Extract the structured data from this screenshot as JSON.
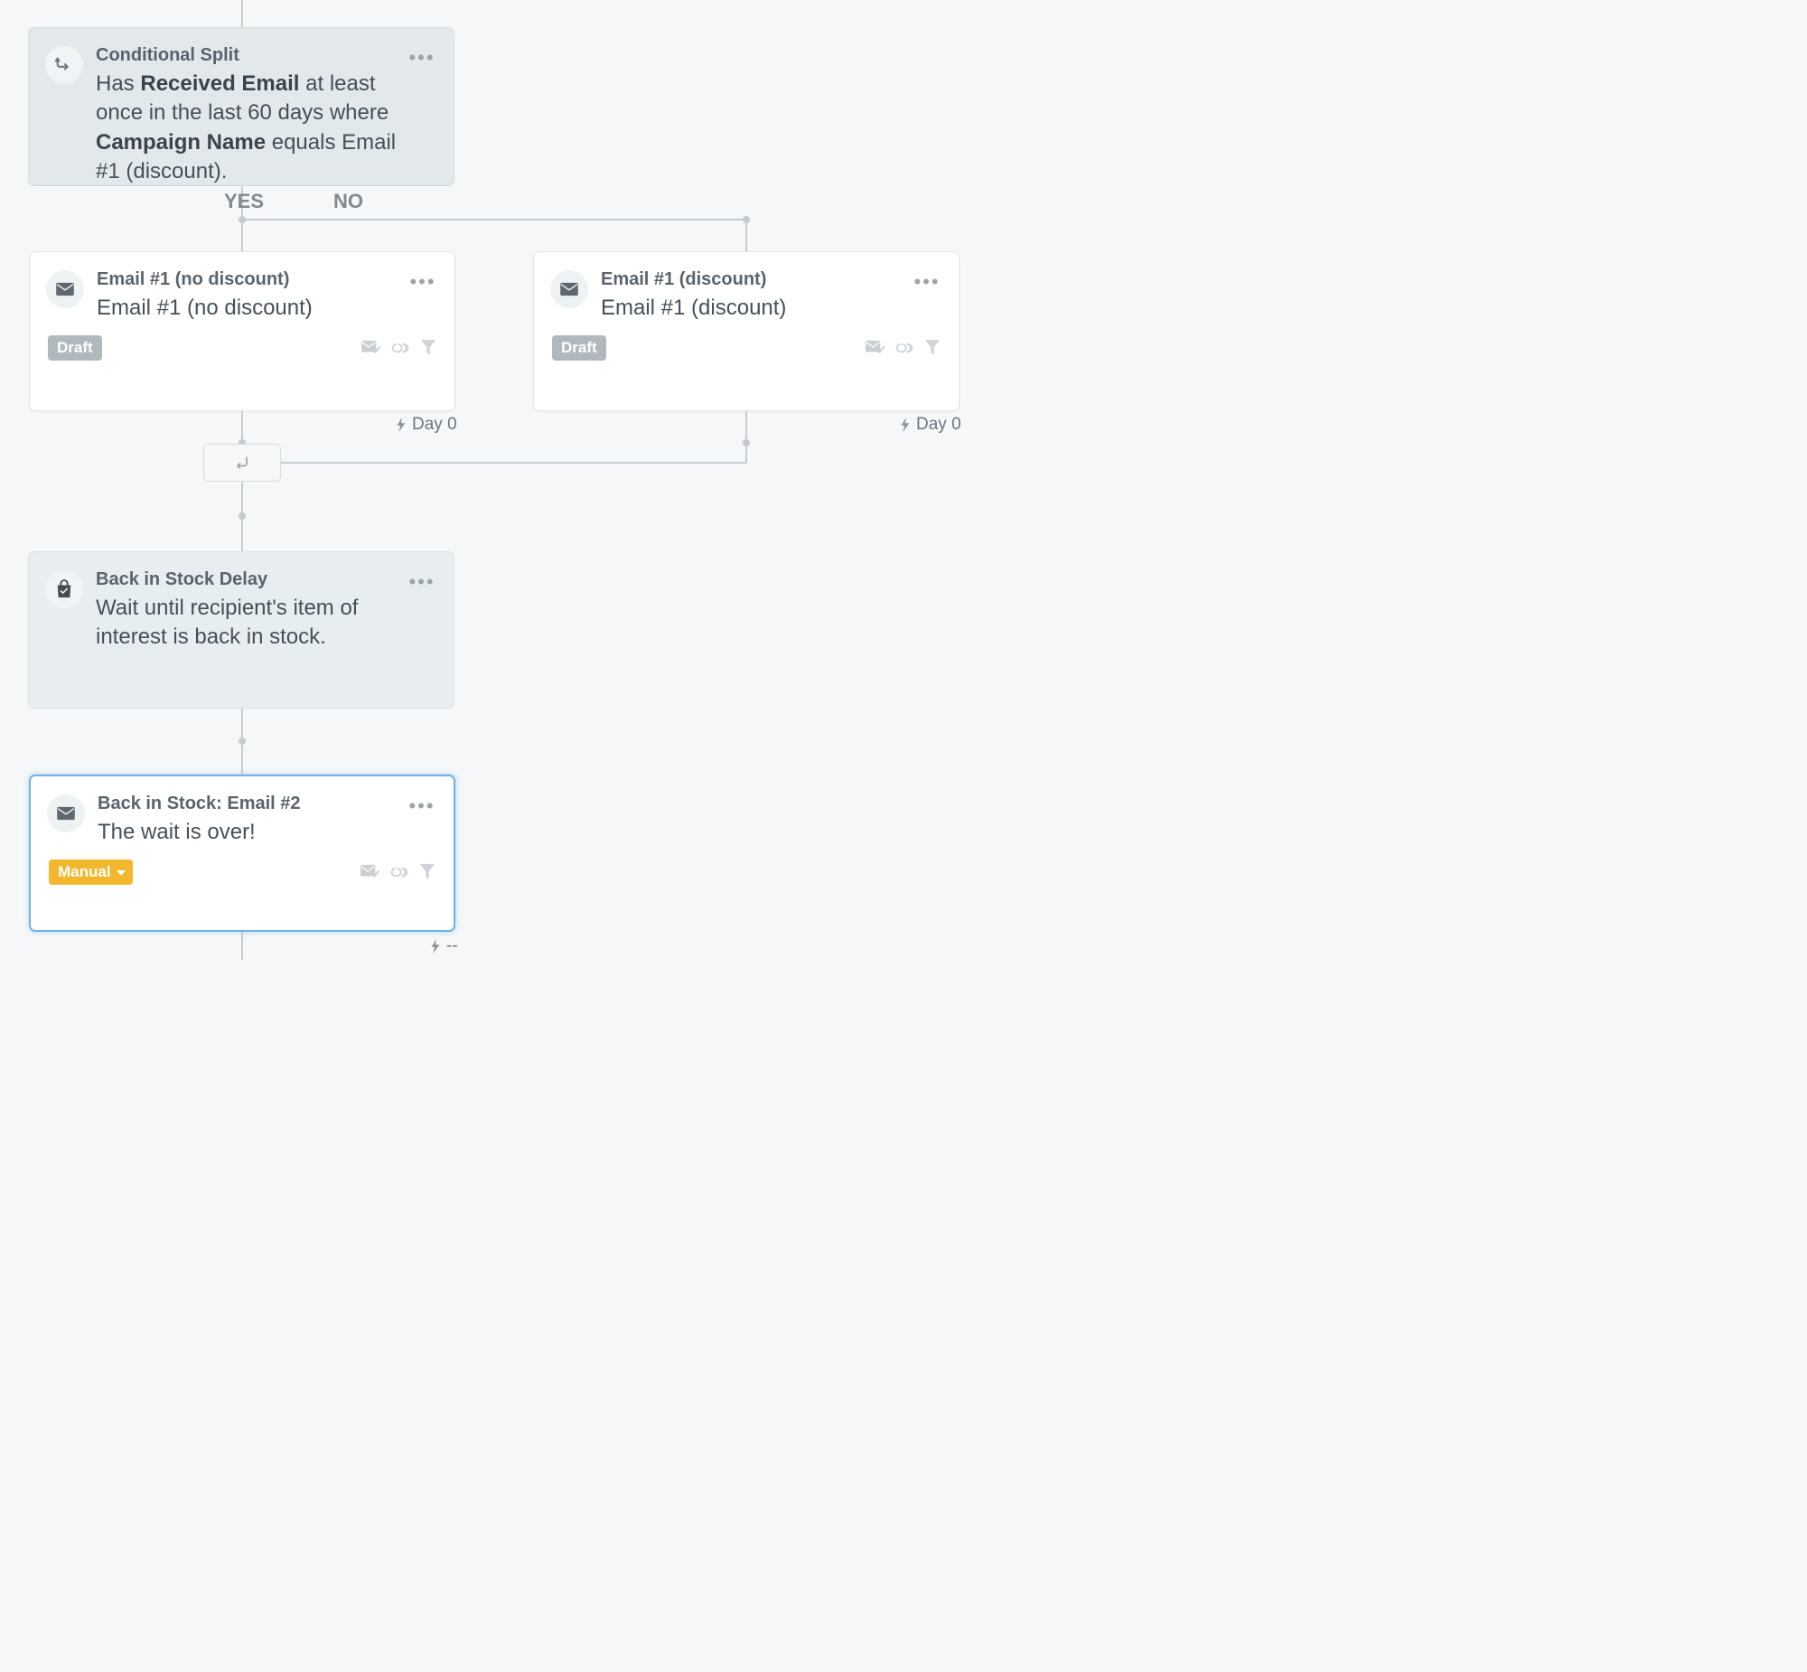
{
  "conditional": {
    "title": "Conditional Split",
    "desc_p1": "Has ",
    "desc_b1": "Received Email",
    "desc_p2": " at least once in the last 60 days where ",
    "desc_b2": "Campaign Name",
    "desc_p3": " equals Email #1 (discount)."
  },
  "branch": {
    "yes": "YES",
    "no": "NO"
  },
  "email_no_discount": {
    "title": "Email #1 (no discount)",
    "subject": "Email #1 (no discount)",
    "status": "Draft",
    "day": "Day 0"
  },
  "email_discount": {
    "title": "Email #1 (discount)",
    "subject": "Email #1 (discount)",
    "status": "Draft",
    "day": "Day 0"
  },
  "back_in_stock_delay": {
    "title": "Back in Stock Delay",
    "desc": "Wait until recipient's item of interest is back in stock."
  },
  "email2": {
    "title": "Back in Stock: Email #2",
    "subject": "The wait is over!",
    "status": "Manual",
    "day": "--"
  }
}
